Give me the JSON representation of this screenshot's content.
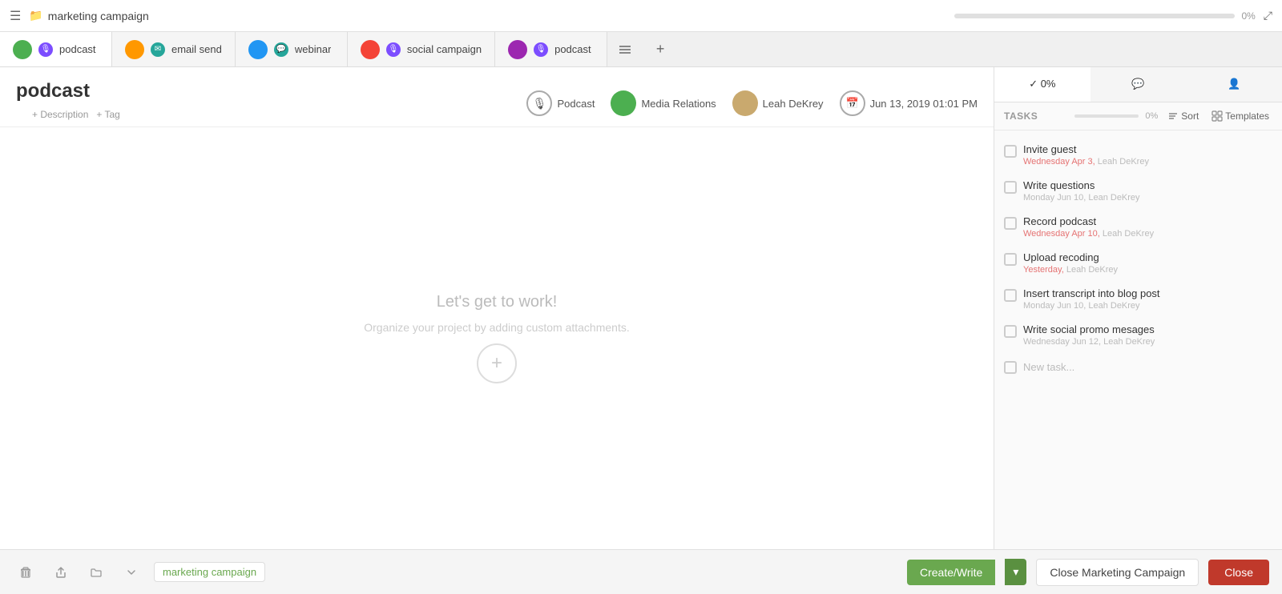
{
  "topbar": {
    "title": "marketing campaign",
    "progress_percent": "0%",
    "progress_value": 0
  },
  "tabs": [
    {
      "id": "tab-podcast-1",
      "label": "podcast",
      "avatar_color": "avatar-green",
      "badge_color": "badge-podcast",
      "badge_symbol": "🎙",
      "active": true
    },
    {
      "id": "tab-email",
      "label": "email send",
      "avatar_color": "avatar-orange",
      "badge_color": "badge-chat",
      "badge_symbol": "✉",
      "active": false
    },
    {
      "id": "tab-webinar",
      "label": "webinar",
      "avatar_color": "avatar-blue",
      "badge_color": "badge-chat",
      "badge_symbol": "💬",
      "active": false
    },
    {
      "id": "tab-social",
      "label": "social campaign",
      "avatar_color": "avatar-red",
      "badge_color": "badge-podcast",
      "badge_symbol": "🎙",
      "active": false
    },
    {
      "id": "tab-podcast-2",
      "label": "podcast",
      "avatar_color": "avatar-purple",
      "badge_color": "badge-podcast",
      "badge_symbol": "🎙",
      "active": false
    }
  ],
  "card": {
    "title": "podcast",
    "add_description": "+ Description",
    "add_tag": "+ Tag",
    "meta": {
      "type_label": "Podcast",
      "group_label": "Media Relations",
      "assignee": "Leah DeKrey",
      "date": "Jun 13, 2019 01:01 PM"
    }
  },
  "empty_state": {
    "title": "Let's get to work!",
    "description": "Organize your project by adding\ncustom attachments."
  },
  "right_panel": {
    "tabs": [
      {
        "id": "tasks-tab",
        "label": "✓ 0%",
        "active": true
      },
      {
        "id": "comments-tab",
        "label": "💬",
        "active": false
      },
      {
        "id": "members-tab",
        "label": "👤",
        "active": false
      }
    ],
    "tasks_label": "TASKS",
    "tasks_percent": "0%",
    "sort_label": "Sort",
    "templates_label": "Templates",
    "tasks": [
      {
        "id": "task-1",
        "name": "Invite guest",
        "due": "Wednesday Apr 3,",
        "assignee": "Leah DeKrey",
        "overdue": true
      },
      {
        "id": "task-2",
        "name": "Write questions",
        "due": "Monday Jun 10,",
        "assignee": "Lean DeKrey",
        "overdue": false
      },
      {
        "id": "task-3",
        "name": "Record podcast",
        "due": "Wednesday Apr 10,",
        "assignee": "Leah DeKrey",
        "overdue": true
      },
      {
        "id": "task-4",
        "name": "Upload recoding",
        "due": "Yesterday,",
        "assignee": "Leah DeKrey",
        "overdue": true
      },
      {
        "id": "task-5",
        "name": "Insert transcript into blog post",
        "due": "Monday Jun 10,",
        "assignee": "Leah DeKrey",
        "overdue": false
      },
      {
        "id": "task-6",
        "name": "Write social promo mesages",
        "due": "Wednesday Jun 12,",
        "assignee": "Leah DeKrey",
        "overdue": false
      }
    ],
    "new_task_placeholder": "New task..."
  },
  "bottom_bar": {
    "breadcrumb": "marketing campaign",
    "create_btn_label": "Create/Write",
    "close_campaign_label": "Close Marketing Campaign",
    "close_label": "Close"
  }
}
